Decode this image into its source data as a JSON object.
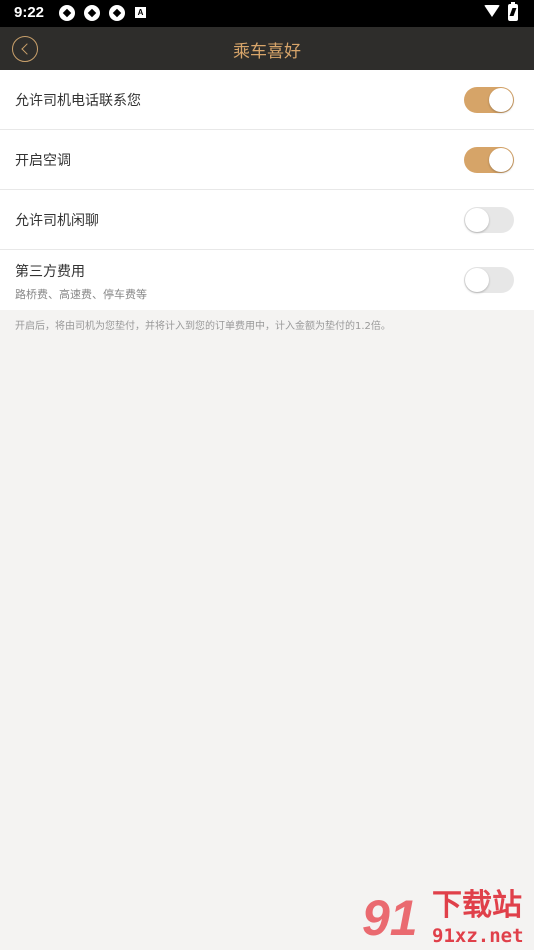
{
  "status_bar": {
    "time": "9:22",
    "notification_icons": [
      "aperture-icon",
      "aperture-icon",
      "aperture-icon",
      "a-badge-icon"
    ],
    "a_badge": "A",
    "system_icons": [
      "wifi-icon",
      "battery-charging-icon"
    ]
  },
  "header": {
    "title": "乘车喜好",
    "back_icon": "chevron-left-icon"
  },
  "settings": [
    {
      "label": "允许司机电话联系您",
      "subtitle": "",
      "enabled": true
    },
    {
      "label": "开启空调",
      "subtitle": "",
      "enabled": true
    },
    {
      "label": "允许司机闲聊",
      "subtitle": "",
      "enabled": false
    },
    {
      "label": "第三方费用",
      "subtitle": "路桥费、高速费、停车费等",
      "enabled": false
    }
  ],
  "note": "开启后，将由司机为您垫付，并将计入到您的订单费用中，计入金额为垫付的1.2倍。",
  "watermark": {
    "logo": "91",
    "title": "下载站",
    "domain": "91xz.net"
  },
  "colors": {
    "accent": "#d6a468",
    "header_bg": "#2e2d2b",
    "header_text": "#d8a56a",
    "page_bg": "#f4f3f2",
    "toggle_off": "#e7e7e7"
  }
}
